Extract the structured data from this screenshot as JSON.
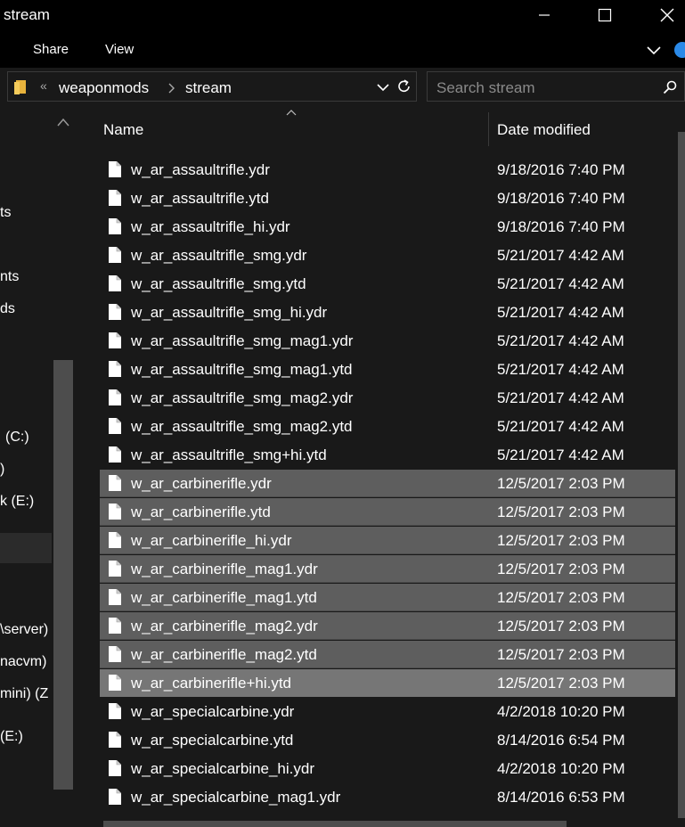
{
  "window": {
    "title": "stream"
  },
  "ribbon": {
    "tabs": [
      "Share",
      "View"
    ]
  },
  "address": {
    "overflow": "«",
    "crumbs": [
      "weaponmods",
      "stream"
    ]
  },
  "search": {
    "placeholder": "Search stream"
  },
  "nav": {
    "items": [
      "ts",
      "nts",
      "ds",
      "(C:)",
      ")",
      "k (E:)",
      "\\server)",
      "nacvm)",
      "mini) (Z",
      "(E:)"
    ]
  },
  "columns": {
    "name": "Name",
    "date": "Date modified"
  },
  "files": [
    {
      "name": "w_ar_assaultrifle.ydr",
      "date": "9/18/2016 7:40 PM"
    },
    {
      "name": "w_ar_assaultrifle.ytd",
      "date": "9/18/2016 7:40 PM"
    },
    {
      "name": "w_ar_assaultrifle_hi.ydr",
      "date": "9/18/2016 7:40 PM"
    },
    {
      "name": "w_ar_assaultrifle_smg.ydr",
      "date": "5/21/2017 4:42 AM"
    },
    {
      "name": "w_ar_assaultrifle_smg.ytd",
      "date": "5/21/2017 4:42 AM"
    },
    {
      "name": "w_ar_assaultrifle_smg_hi.ydr",
      "date": "5/21/2017 4:42 AM"
    },
    {
      "name": "w_ar_assaultrifle_smg_mag1.ydr",
      "date": "5/21/2017 4:42 AM"
    },
    {
      "name": "w_ar_assaultrifle_smg_mag1.ytd",
      "date": "5/21/2017 4:42 AM"
    },
    {
      "name": "w_ar_assaultrifle_smg_mag2.ydr",
      "date": "5/21/2017 4:42 AM"
    },
    {
      "name": "w_ar_assaultrifle_smg_mag2.ytd",
      "date": "5/21/2017 4:42 AM"
    },
    {
      "name": "w_ar_assaultrifle_smg+hi.ytd",
      "date": "5/21/2017 4:42 AM"
    },
    {
      "name": "w_ar_carbinerifle.ydr",
      "date": "12/5/2017 2:03 PM"
    },
    {
      "name": "w_ar_carbinerifle.ytd",
      "date": "12/5/2017 2:03 PM"
    },
    {
      "name": "w_ar_carbinerifle_hi.ydr",
      "date": "12/5/2017 2:03 PM"
    },
    {
      "name": "w_ar_carbinerifle_mag1.ydr",
      "date": "12/5/2017 2:03 PM"
    },
    {
      "name": "w_ar_carbinerifle_mag1.ytd",
      "date": "12/5/2017 2:03 PM"
    },
    {
      "name": "w_ar_carbinerifle_mag2.ydr",
      "date": "12/5/2017 2:03 PM"
    },
    {
      "name": "w_ar_carbinerifle_mag2.ytd",
      "date": "12/5/2017 2:03 PM"
    },
    {
      "name": "w_ar_carbinerifle+hi.ytd",
      "date": "12/5/2017 2:03 PM"
    },
    {
      "name": "w_ar_specialcarbine.ydr",
      "date": "4/2/2018 10:20 PM"
    },
    {
      "name": "w_ar_specialcarbine.ytd",
      "date": "8/14/2016 6:54 PM"
    },
    {
      "name": "w_ar_specialcarbine_hi.ydr",
      "date": "4/2/2018 10:20 PM"
    },
    {
      "name": "w_ar_specialcarbine_mag1.ydr",
      "date": "8/14/2016 6:53 PM"
    }
  ],
  "colors": {
    "background": "#191919",
    "selected": "#5e5e5e",
    "focused": "#767676",
    "accent": "#2b8ae8"
  }
}
